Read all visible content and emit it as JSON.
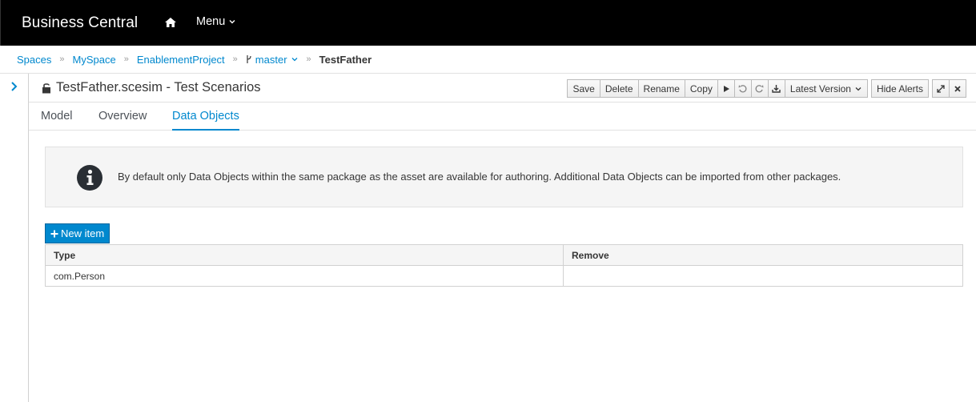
{
  "app": {
    "brand": "Business Central",
    "menu_label": "Menu"
  },
  "breadcrumb": {
    "items": [
      "Spaces",
      "MySpace",
      "EnablementProject"
    ],
    "branch": "master",
    "current": "TestFather"
  },
  "editor": {
    "title": "TestFather.scesim - Test Scenarios",
    "toolbar": {
      "save": "Save",
      "delete": "Delete",
      "rename": "Rename",
      "copy": "Copy",
      "version": "Latest Version",
      "hide_alerts": "Hide Alerts"
    },
    "tabs": [
      "Model",
      "Overview",
      "Data Objects"
    ],
    "active_tab": "Data Objects"
  },
  "alert": {
    "text": "By default only Data Objects within the same package as the asset are available for authoring. Additional Data Objects can be imported from other packages."
  },
  "data_objects": {
    "new_item_label": "New item",
    "columns": [
      "Type",
      "Remove"
    ],
    "rows": [
      {
        "type": "com.Person",
        "remove": ""
      }
    ]
  },
  "colors": {
    "accent": "#0088ce",
    "topbar": "#000000"
  }
}
